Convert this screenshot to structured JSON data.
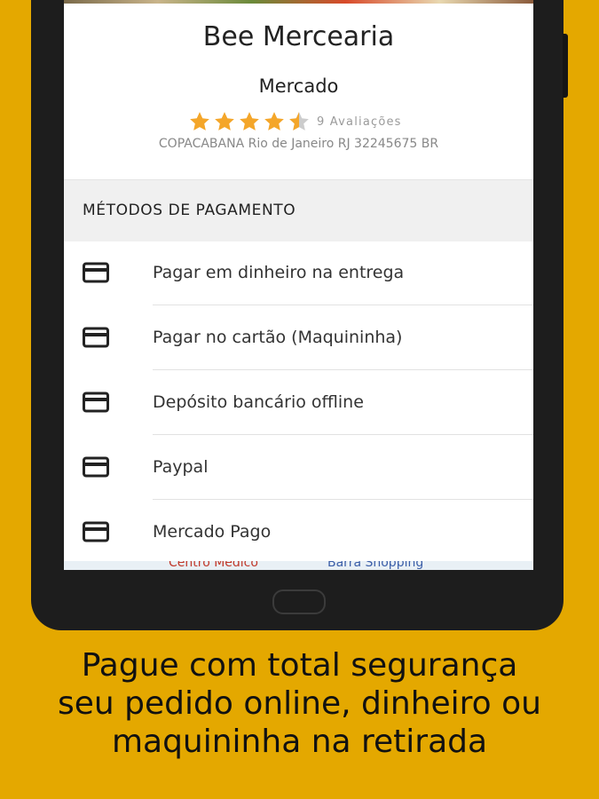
{
  "store": {
    "name": "Bee Mercearia",
    "category": "Mercado",
    "rating": 4.5,
    "rating_max": 5,
    "reviews_label": "9 Avaliações",
    "address": "COPACABANA Rio de Janeiro RJ 32245675 BR"
  },
  "payment": {
    "header": "MÉTODOS DE PAGAMENTO",
    "items": [
      {
        "label": "Pagar em dinheiro na entrega",
        "icon": "credit-card-icon"
      },
      {
        "label": "Pagar no cartão (Maquininha)",
        "icon": "credit-card-icon"
      },
      {
        "label": "Depósito bancário offline",
        "icon": "credit-card-icon"
      },
      {
        "label": "Paypal",
        "icon": "credit-card-icon"
      },
      {
        "label": "Mercado Pago",
        "icon": "credit-card-icon"
      }
    ]
  },
  "map_peek": {
    "labels": [
      "Centro Médico",
      "Barra Shopping"
    ]
  },
  "caption": {
    "lines": [
      "Pague com total segurança",
      "seu pedido online, dinheiro ou",
      "maquininha na retirada"
    ]
  },
  "colors": {
    "background": "#E4A800",
    "star": "#F4A62A",
    "star_empty": "#cccccc",
    "device": "#1d1d1d"
  }
}
